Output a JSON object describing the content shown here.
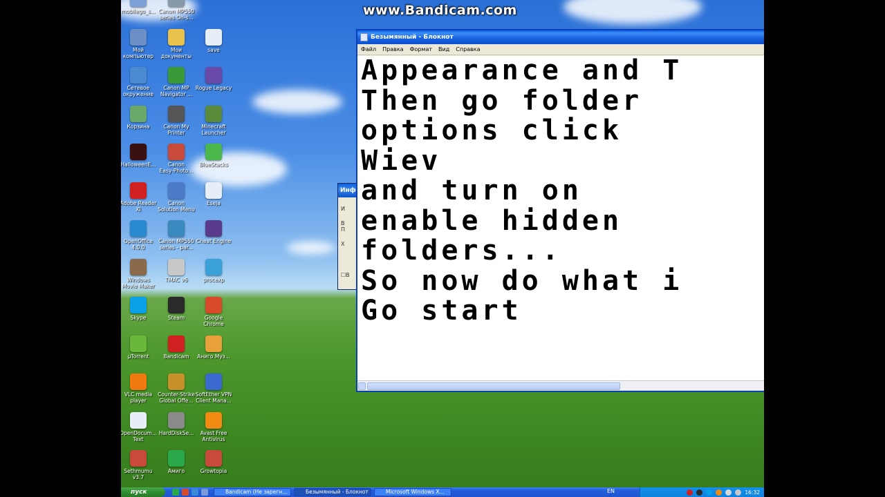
{
  "watermark": "www.Bandicam.com",
  "desktop_icons": [
    {
      "label": "mobilego_s...",
      "icon": "generic-icon",
      "color": "#7aa0d6"
    },
    {
      "label": "Canon MP550\nseries On-s...",
      "icon": "canon-icon",
      "color": "#8899aa"
    },
    {
      "label": "Мой\nкомпьютер",
      "icon": "my-computer-icon",
      "color": "#6d8fc7"
    },
    {
      "label": "Мои\nдокументы",
      "icon": "my-documents-icon",
      "color": "#e8c24a"
    },
    {
      "label": "save",
      "icon": "document-icon",
      "color": "#e8eef8"
    },
    {
      "label": "Сетевое\nокружение",
      "icon": "network-icon",
      "color": "#4a8ad0"
    },
    {
      "label": "Canon MP\nNavigator ...",
      "icon": "canon-navigator-icon",
      "color": "#3a9a3a"
    },
    {
      "label": "Rogue Legacy",
      "icon": "rogue-legacy-icon",
      "color": "#6a4aa8"
    },
    {
      "label": "Корзина",
      "icon": "recycle-bin-icon",
      "color": "#6aa86a"
    },
    {
      "label": "Canon My\nPrinter",
      "icon": "canon-printer-icon",
      "color": "#555555"
    },
    {
      "label": "Minecraft\nLauncher",
      "icon": "minecraft-icon",
      "color": "#5a8a3a"
    },
    {
      "label": "HalloweenE...",
      "icon": "halloween-icon",
      "color": "#3a1010"
    },
    {
      "label": "Canon\nEasy-Photo...",
      "icon": "canon-easy-photo-icon",
      "color": "#c84a3a"
    },
    {
      "label": "BlueStacks",
      "icon": "bluestacks-icon",
      "color": "#4ab84a"
    },
    {
      "label": "Adobe Reader\nXI",
      "icon": "adobe-reader-icon",
      "color": "#d02020"
    },
    {
      "label": "Canon\nSolution Menu",
      "icon": "canon-solution-icon",
      "color": "#4a7ac8"
    },
    {
      "label": "Eseja",
      "icon": "document-icon",
      "color": "#e8eef8"
    },
    {
      "label": "OpenOffice\n4.0.0",
      "icon": "openoffice-icon",
      "color": "#2a8ad0"
    },
    {
      "label": "Canon MP550\nseries - par...",
      "icon": "canon-series-icon",
      "color": "#3a8ac0"
    },
    {
      "label": "Cheat Engine",
      "icon": "cheat-engine-icon",
      "color": "#5a3a8a"
    },
    {
      "label": "Windows\nMovie Maker",
      "icon": "movie-maker-icon",
      "color": "#8a6a4a"
    },
    {
      "label": "TMAC v6",
      "icon": "tmac-icon",
      "color": "#c8c8c8"
    },
    {
      "label": "procexp",
      "icon": "procexp-icon",
      "color": "#3aa0d8"
    },
    {
      "label": "Skype",
      "icon": "skype-icon",
      "color": "#0aa0e8"
    },
    {
      "label": "Steam",
      "icon": "steam-icon",
      "color": "#2a2a2a"
    },
    {
      "label": "Google\nChrome",
      "icon": "chrome-icon",
      "color": "#d84a2a"
    },
    {
      "label": "µTorrent",
      "icon": "utorrent-icon",
      "color": "#6ab83a"
    },
    {
      "label": "Bandicam",
      "icon": "bandicam-icon",
      "color": "#d02020"
    },
    {
      "label": "Аниго.Муз...",
      "icon": "amigo-music-icon",
      "color": "#e8a03a"
    },
    {
      "label": "VLC media\nplayer",
      "icon": "vlc-icon",
      "color": "#f07a10"
    },
    {
      "label": "Counter-Strike\nGlobal Offe...",
      "icon": "csgo-icon",
      "color": "#c8902a"
    },
    {
      "label": "SoftEther VPN\nClient Mana...",
      "icon": "softether-icon",
      "color": "#3a6ad0"
    },
    {
      "label": "OpenDocum...\nText",
      "icon": "opendocument-icon",
      "color": "#e8eef8"
    },
    {
      "label": "HardDiskSe...",
      "icon": "harddisk-icon",
      "color": "#8a8a8a"
    },
    {
      "label": "Avast Free\nAntivirus",
      "icon": "avast-icon",
      "color": "#f08a10"
    },
    {
      "label": "Sethmumu\nv3.7",
      "icon": "sethmumu-icon",
      "color": "#c84a3a"
    },
    {
      "label": "Амиго",
      "icon": "amigo-icon",
      "color": "#2aa84a"
    },
    {
      "label": "Growtopia",
      "icon": "growtopia-icon",
      "color": "#c84a3a"
    }
  ],
  "background_dialog": {
    "title": "Инф",
    "lines": [
      "И",
      "В",
      "П",
      "Х",
      "В"
    ]
  },
  "notepad": {
    "title": "Безымянный - Блокнот",
    "menu": [
      "Файл",
      "Правка",
      "Формат",
      "Вид",
      "Справка"
    ],
    "lines": [
      "Appearance and T",
      "Then go folder",
      "options click",
      "Wiev",
      "and turn on",
      "enable hidden",
      "folders...",
      "So now do what i",
      "Go start"
    ]
  },
  "taskbar": {
    "start_label": "пуск",
    "tasks": [
      "Bandicam (Не зарегн...",
      "Безымянный - Блокнот",
      "Microsoft Windows X..."
    ],
    "active_task_index": 1,
    "language": "EN",
    "clock": "16:32"
  }
}
